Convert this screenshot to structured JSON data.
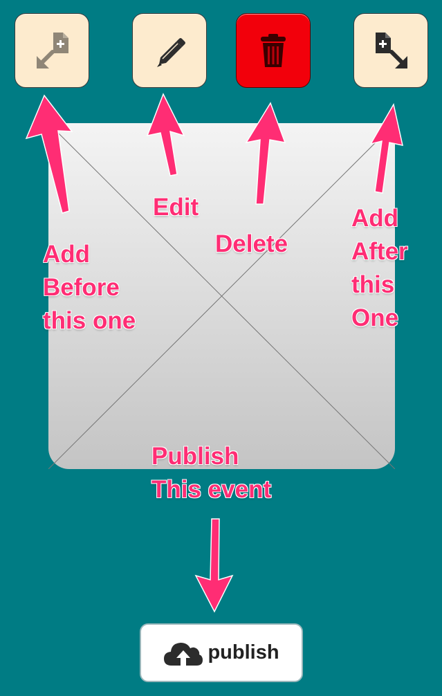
{
  "toolbar": {
    "add_before_icon": "add-before-icon",
    "edit_icon": "pencil-icon",
    "delete_icon": "trash-icon",
    "add_after_icon": "add-after-icon",
    "delete_color": "#f2000b",
    "button_color": "#fdebce"
  },
  "annotations": {
    "add_before": [
      "Add",
      "Before",
      "this one"
    ],
    "edit": "Edit",
    "delete": "Delete",
    "add_after": [
      "Add",
      "After",
      "this",
      "One"
    ],
    "publish": [
      "Publish",
      "This event"
    ],
    "color": "#ff2d74"
  },
  "publish_button": {
    "label": "publish",
    "icon": "cloud-upload-icon"
  },
  "background_color": "#007c84"
}
